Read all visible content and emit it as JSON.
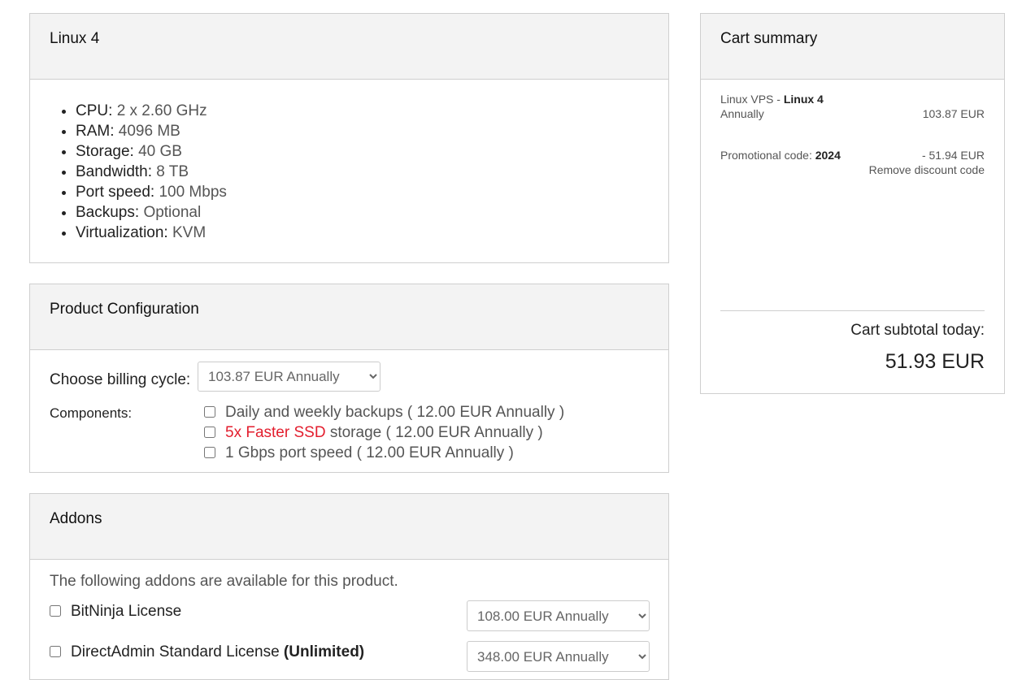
{
  "product": {
    "title": "Linux 4",
    "specs": [
      {
        "key": "CPU:",
        "value": "2 x 2.60 GHz"
      },
      {
        "key": "RAM:",
        "value": "4096 MB"
      },
      {
        "key": "Storage:",
        "value": "40 GB"
      },
      {
        "key": "Bandwidth:",
        "value": "8 TB"
      },
      {
        "key": "Port speed:",
        "value": "100 Mbps"
      },
      {
        "key": "Backups:",
        "value": "Optional"
      },
      {
        "key": "Virtualization:",
        "value": "KVM"
      }
    ]
  },
  "configuration": {
    "title": "Product Configuration",
    "billing_label": "Choose billing cycle:",
    "billing_value": "103.87 EUR Annually",
    "components_label": "Components:",
    "components": [
      {
        "prefix": "",
        "highlight": "",
        "text": "Daily and weekly backups ( 12.00 EUR Annually )",
        "checked": false
      },
      {
        "prefix": "",
        "highlight": "5x Faster SSD",
        "text": " storage ( 12.00 EUR Annually )",
        "checked": false
      },
      {
        "prefix": "",
        "highlight": "",
        "text": "1 Gbps port speed ( 12.00 EUR Annually )",
        "checked": false
      }
    ]
  },
  "addons": {
    "title": "Addons",
    "intro": "The following addons are available for this product.",
    "items": [
      {
        "name": "BitNinja License",
        "suffix": "",
        "price": "108.00 EUR Annually",
        "checked": false
      },
      {
        "name": "DirectAdmin Standard License ",
        "suffix": "(Unlimited)",
        "price": "348.00 EUR Annually",
        "checked": false
      }
    ]
  },
  "cart": {
    "title": "Cart summary",
    "item_group": "Linux VPS - ",
    "item_name": "Linux 4",
    "item_cycle": "Annually",
    "item_price": "103.87 EUR",
    "promo_label": "Promotional code: ",
    "promo_code": "2024",
    "promo_amount": "- 51.94 EUR",
    "remove_discount": "Remove discount code",
    "subtotal_label": "Cart subtotal today:",
    "subtotal_value": "51.93 EUR"
  },
  "colors": {
    "accent_red": "#e31e2e",
    "panel_head": "#f3f3f3",
    "border": "#cfcfcf"
  }
}
